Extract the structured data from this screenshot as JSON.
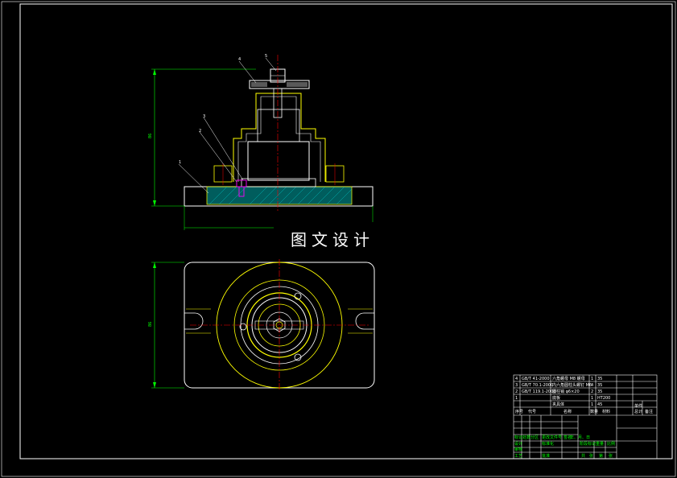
{
  "watermark": "图文设计",
  "colors": {
    "background": "#000000",
    "frame": "#ffffff",
    "outline": "#ffff00",
    "section_fill": "#00aaaa",
    "centerline": "#ff0000",
    "dimension": "#00ff00",
    "leader": "#ffffff",
    "bolt": "#ff00ff",
    "titleblock_green": "#00ff00"
  },
  "balloons": [
    "1",
    "2",
    "3",
    "4",
    "5"
  ],
  "dimension_values": {
    "front_height": "86",
    "plan_height": "86"
  },
  "title_block": {
    "revision_rows": [
      [
        "4",
        "GB/T 41-2000",
        "六角螺母 M8 螺母",
        "1",
        "35"
      ],
      [
        "3",
        "GB/T 70.1-2000",
        "内六角圆柱头螺钉 M6",
        "4",
        "35"
      ],
      [
        "2",
        "GB/T 119.1-2000",
        "圆柱销 φ6×20",
        "2",
        "35"
      ],
      [
        "1",
        "",
        "底板",
        "1",
        "HT200"
      ],
      [
        "",
        "",
        "夹具体",
        "1",
        "45"
      ]
    ],
    "headers": [
      "序号",
      "代号",
      "名称",
      "数量",
      "材料",
      "单件",
      "总计",
      "备注"
    ],
    "sign_labels": [
      "标记",
      "处数",
      "分区",
      "更改文件号",
      "签名",
      "年、月、日"
    ],
    "design_labels": [
      "设计",
      "标准化",
      "审核",
      "工艺",
      "批准"
    ],
    "stage_labels": [
      "阶段标记",
      "重量",
      "比例"
    ],
    "sheet_labels": [
      "共",
      "张",
      "第",
      "张"
    ]
  }
}
